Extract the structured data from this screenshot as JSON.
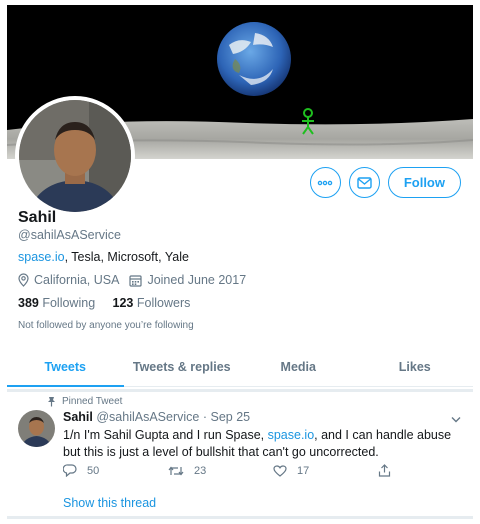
{
  "profile": {
    "name": "Sahil",
    "handle": "@sahilAsAService",
    "bio_link": "spase.io",
    "bio_rest": ", Tesla, Microsoft, Yale",
    "location": "California, USA",
    "joined": "Joined June 2017",
    "following_count": "389",
    "following_label": "Following",
    "followers_count": "123",
    "followers_label": "Followers",
    "followed_note": "Not followed by anyone you’re following"
  },
  "actions": {
    "more_icon": "more-icon",
    "message_icon": "envelope-icon",
    "follow_label": "Follow"
  },
  "tabs": [
    {
      "label": "Tweets",
      "active": true
    },
    {
      "label": "Tweets & replies",
      "active": false
    },
    {
      "label": "Media",
      "active": false
    },
    {
      "label": "Likes",
      "active": false
    }
  ],
  "tweet": {
    "pinned_label": "Pinned Tweet",
    "author_name": "Sahil",
    "author_handle": "@sahilAsAService",
    "separator": "·",
    "date": "Sep 25",
    "text_before": "1/n I'm Sahil Gupta and I run Spase, ",
    "text_link": "spase.io",
    "text_after": ", and I can handle abuse but this is just a level of bullshit that can't go uncorrected.",
    "replies": "50",
    "retweets": "23",
    "likes": "17",
    "show_thread": "Show this thread"
  },
  "colors": {
    "accent": "#1da1f2",
    "link": "#1b95e0",
    "muted": "#657786",
    "text": "#14171a"
  }
}
